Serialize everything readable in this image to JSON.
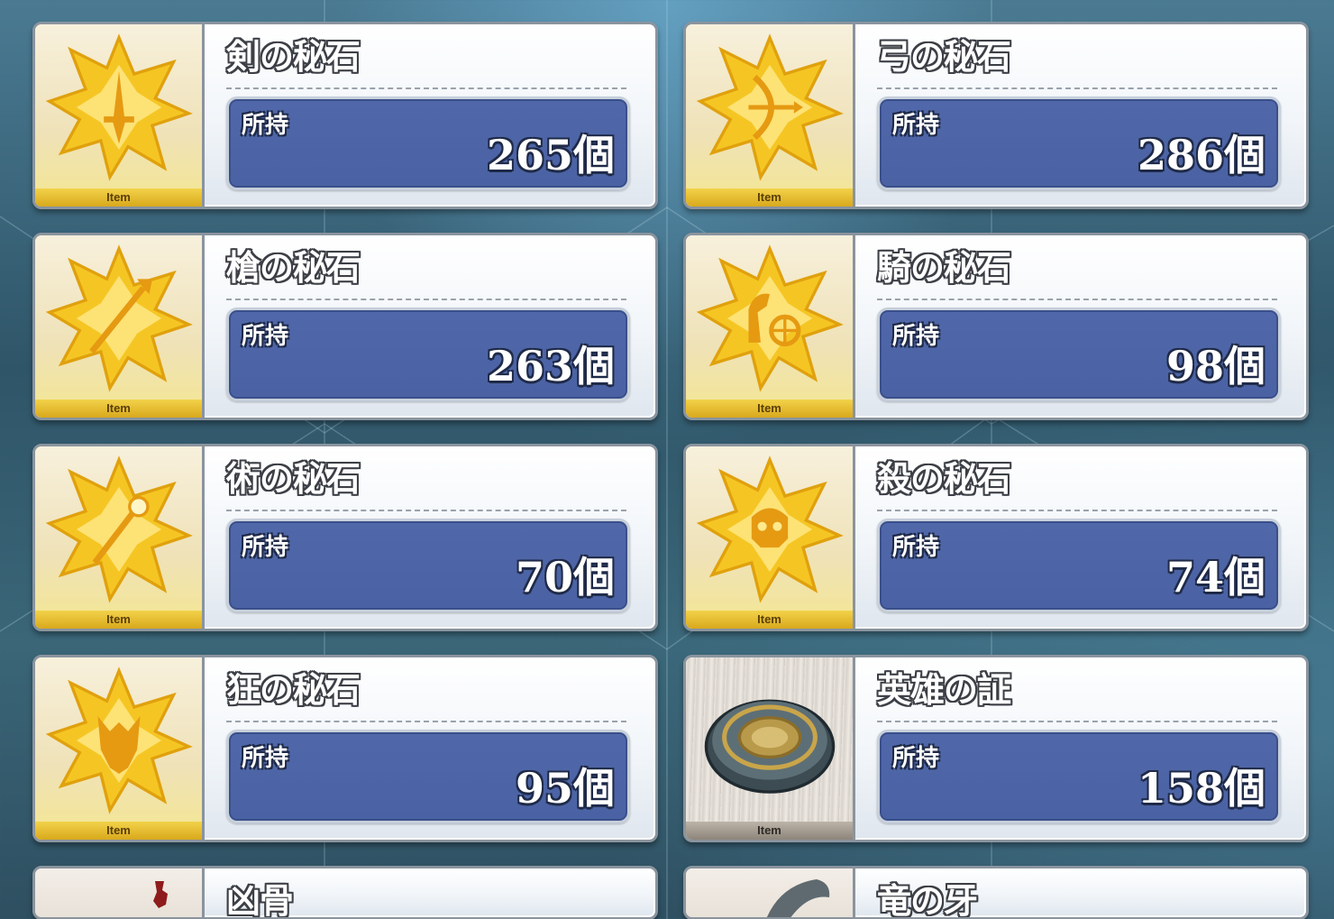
{
  "own_label": "所持",
  "thumb_label": "Item",
  "items": [
    {
      "name": "剣の秘石",
      "count": "265個",
      "icon": "saber-gem-icon"
    },
    {
      "name": "弓の秘石",
      "count": "286個",
      "icon": "archer-gem-icon"
    },
    {
      "name": "槍の秘石",
      "count": "263個",
      "icon": "lancer-gem-icon"
    },
    {
      "name": "騎の秘石",
      "count": "98個",
      "icon": "rider-gem-icon"
    },
    {
      "name": "術の秘石",
      "count": "70個",
      "icon": "caster-gem-icon"
    },
    {
      "name": "殺の秘石",
      "count": "74個",
      "icon": "assassin-gem-icon"
    },
    {
      "name": "狂の秘石",
      "count": "95個",
      "icon": "berserker-gem-icon"
    },
    {
      "name": "英雄の証",
      "count": "158個",
      "icon": "proof-of-hero-icon"
    },
    {
      "name": "凶骨",
      "icon": "evil-bone-icon"
    },
    {
      "name": "竜の牙",
      "icon": "dragon-fang-icon"
    }
  ],
  "colors": {
    "count_box": "#4e66a8",
    "gem_gold": "#f5c623",
    "frame_border": "#8a949e"
  }
}
